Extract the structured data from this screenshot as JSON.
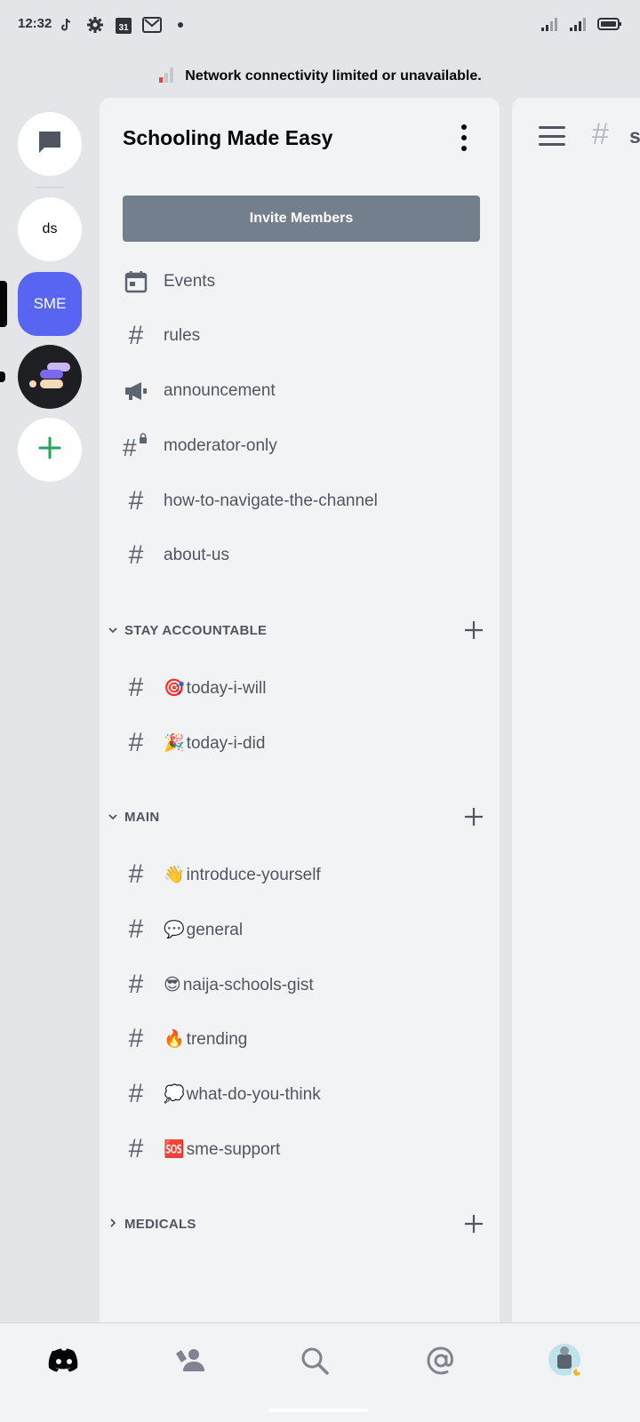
{
  "status_bar": {
    "time": "12:32",
    "left_icons": [
      "tiktok-icon",
      "settings-gear-icon",
      "calendar-icon",
      "gmail-icon",
      "dot-icon"
    ],
    "calendar_day": "31",
    "right_icons": [
      "signal-icon",
      "signal-icon-2",
      "battery-icon"
    ]
  },
  "network_banner": {
    "text": "Network connectivity limited or unavailable."
  },
  "server_rail": {
    "servers": [
      {
        "label": "",
        "icon": "chat-bubble-icon"
      },
      {
        "label": "ds"
      },
      {
        "label": "SME",
        "selected": true
      },
      {
        "label": "",
        "icon": "server-logo-icon"
      },
      {
        "label": "",
        "icon": "add-server-icon"
      }
    ]
  },
  "channel_panel": {
    "server_name": "Schooling Made Easy",
    "invite_label": "Invite Members",
    "top_channels": [
      {
        "label": "Events",
        "icon": "calendar-icon"
      },
      {
        "label": "rules",
        "icon": "hash-icon"
      },
      {
        "label": "announcement",
        "icon": "megaphone-icon"
      },
      {
        "label": "moderator-only",
        "icon": "locked-hash-icon"
      },
      {
        "label": "how-to-navigate-the-channel",
        "icon": "hash-icon"
      },
      {
        "label": "about-us",
        "icon": "hash-icon"
      }
    ],
    "categories": [
      {
        "name": "STAY ACCOUNTABLE",
        "expanded": true,
        "channels": [
          {
            "emoji": "🎯",
            "label": "today-i-will"
          },
          {
            "emoji": "🎉",
            "label": "today-i-did"
          }
        ]
      },
      {
        "name": "MAIN",
        "expanded": true,
        "channels": [
          {
            "emoji": "👋",
            "label": "introduce-yourself"
          },
          {
            "emoji": "💬",
            "label": "general"
          },
          {
            "emoji": "😎",
            "label": "naija-schools-gist"
          },
          {
            "emoji": "🔥",
            "label": "trending"
          },
          {
            "emoji": "💭",
            "label": "what-do-you-think"
          },
          {
            "emoji": "🆘",
            "label": "sme-support"
          }
        ]
      },
      {
        "name": "MEDICALS",
        "expanded": false,
        "channels": []
      }
    ]
  },
  "chat_pane": {
    "title_partial": "s"
  },
  "bottom_nav": {
    "items": [
      "discord-home-icon",
      "friends-icon",
      "search-icon",
      "mentions-icon",
      "profile-avatar-icon"
    ]
  },
  "colors": {
    "blurple": "#5865f2",
    "invite_button": "#747f8d",
    "channel_text": "#4f5660",
    "add_green": "#23a55a"
  }
}
